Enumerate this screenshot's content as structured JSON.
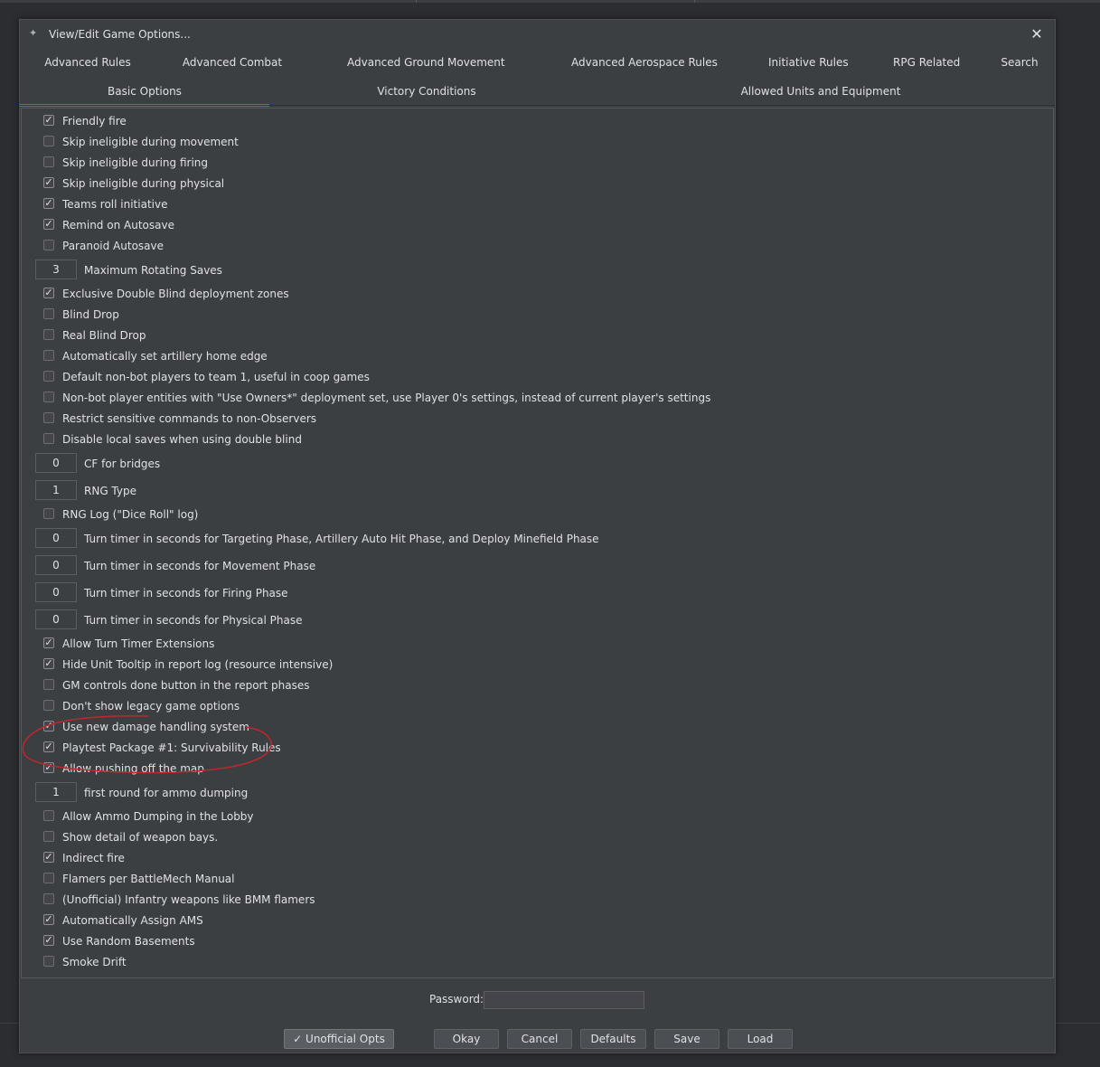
{
  "window": {
    "title": "View/Edit Game Options..."
  },
  "tabs_row1": [
    "Advanced Rules",
    "Advanced Combat",
    "Advanced Ground Movement",
    "Advanced Aerospace Rules",
    "Initiative Rules",
    "RPG Related",
    "Search"
  ],
  "tabs_row2": [
    "Basic Options",
    "Victory Conditions",
    "Allowed Units and Equipment"
  ],
  "selected_tab": "Basic Options",
  "options": [
    {
      "type": "checkbox",
      "label": "Friendly fire",
      "checked": true
    },
    {
      "type": "checkbox",
      "label": "Skip ineligible during movement",
      "checked": false
    },
    {
      "type": "checkbox",
      "label": "Skip ineligible during firing",
      "checked": false
    },
    {
      "type": "checkbox",
      "label": "Skip ineligible during physical",
      "checked": true
    },
    {
      "type": "checkbox",
      "label": "Teams roll initiative",
      "checked": true
    },
    {
      "type": "checkbox",
      "label": "Remind on Autosave",
      "checked": true
    },
    {
      "type": "checkbox",
      "label": "Paranoid Autosave",
      "checked": false
    },
    {
      "type": "number",
      "label": "Maximum Rotating Saves",
      "value": "3"
    },
    {
      "type": "checkbox",
      "label": "Exclusive Double Blind deployment zones",
      "checked": true
    },
    {
      "type": "checkbox",
      "label": "Blind Drop",
      "checked": false
    },
    {
      "type": "checkbox",
      "label": "Real Blind Drop",
      "checked": false
    },
    {
      "type": "checkbox",
      "label": "Automatically set artillery home edge",
      "checked": false
    },
    {
      "type": "checkbox",
      "label": "Default non-bot players to team 1, useful in coop games",
      "checked": false
    },
    {
      "type": "checkbox",
      "label": "Non-bot player entities with \"Use Owners*\" deployment set, use Player 0's settings, instead of current player's settings",
      "checked": false
    },
    {
      "type": "checkbox",
      "label": "Restrict sensitive commands to non-Observers",
      "checked": false
    },
    {
      "type": "checkbox",
      "label": "Disable local saves when using double blind",
      "checked": false
    },
    {
      "type": "number",
      "label": "CF for bridges",
      "value": "0"
    },
    {
      "type": "number",
      "label": "RNG Type",
      "value": "1"
    },
    {
      "type": "checkbox",
      "label": "RNG Log (\"Dice Roll\" log)",
      "checked": false
    },
    {
      "type": "number",
      "label": "Turn timer in seconds for Targeting Phase, Artillery Auto Hit Phase, and Deploy Minefield Phase",
      "value": "0"
    },
    {
      "type": "number",
      "label": "Turn timer in seconds for Movement Phase",
      "value": "0"
    },
    {
      "type": "number",
      "label": "Turn timer in seconds for Firing Phase",
      "value": "0"
    },
    {
      "type": "number",
      "label": "Turn timer in seconds for Physical Phase",
      "value": "0"
    },
    {
      "type": "checkbox",
      "label": "Allow Turn Timer Extensions",
      "checked": true
    },
    {
      "type": "checkbox",
      "label": "Hide Unit Tooltip in report log (resource intensive)",
      "checked": true
    },
    {
      "type": "checkbox",
      "label": "GM controls done button in the report phases",
      "checked": false
    },
    {
      "type": "checkbox",
      "label": "Don't show legacy game options",
      "checked": false
    },
    {
      "type": "checkbox",
      "label": "Use new damage handling system",
      "checked": true
    },
    {
      "type": "checkbox",
      "label": "Playtest Package #1: Survivability Rules",
      "checked": true
    },
    {
      "type": "checkbox",
      "label": "Allow pushing off the map",
      "checked": true
    },
    {
      "type": "number",
      "label": "first round for ammo dumping",
      "value": "1"
    },
    {
      "type": "checkbox",
      "label": "Allow Ammo Dumping in the Lobby",
      "checked": false
    },
    {
      "type": "checkbox",
      "label": "Show detail of weapon bays.",
      "checked": false
    },
    {
      "type": "checkbox",
      "label": "Indirect fire",
      "checked": true
    },
    {
      "type": "checkbox",
      "label": "Flamers per BattleMech Manual",
      "checked": false
    },
    {
      "type": "checkbox",
      "label": "(Unofficial) Infantry weapons like BMM flamers",
      "checked": false
    },
    {
      "type": "checkbox",
      "label": "Automatically Assign AMS",
      "checked": true
    },
    {
      "type": "checkbox",
      "label": "Use Random Basements",
      "checked": true
    },
    {
      "type": "checkbox",
      "label": "Smoke Drift",
      "checked": false
    }
  ],
  "footer": {
    "password_label": "Password:",
    "password_value": "",
    "unofficial_label": "✓ Unofficial Opts",
    "okay_label": "Okay",
    "cancel_label": "Cancel",
    "defaults_label": "Defaults",
    "save_label": "Save",
    "load_label": "Load"
  },
  "colors": {
    "background": "#3c3f41",
    "selected_tab_underline": "#3574f0",
    "annotation_circle": "#c0272d"
  }
}
